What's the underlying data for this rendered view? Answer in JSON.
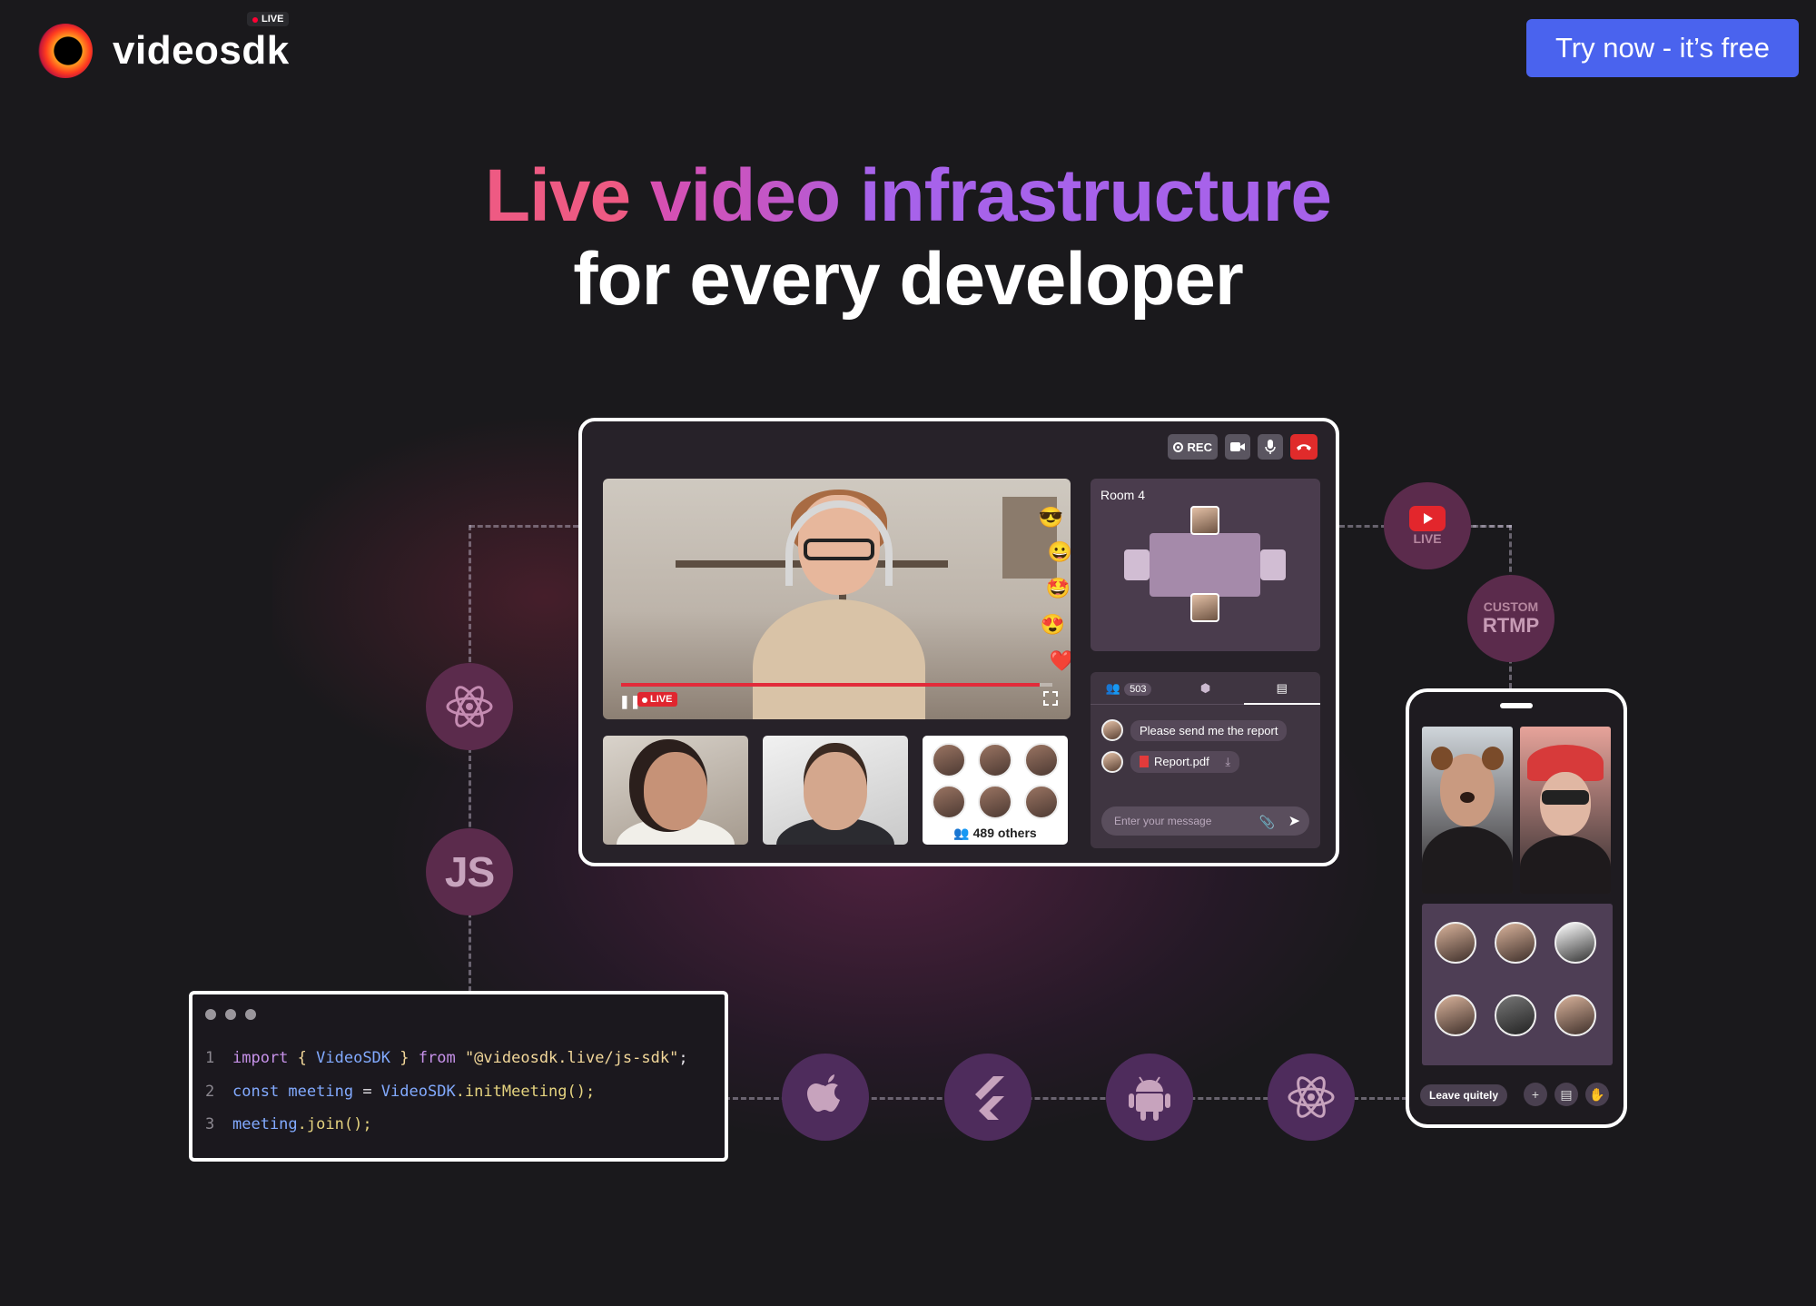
{
  "header": {
    "brand": "videosdk",
    "brand_badge": "LIVE",
    "cta_label": "Try now - it’s free"
  },
  "hero": {
    "line1_part1": "Live ",
    "line1_part2": "video ",
    "line1_part3": "infrastructure",
    "line2": "for every developer"
  },
  "call": {
    "toolbar": {
      "rec_label": "REC"
    },
    "main_video": {
      "live_label": "LIVE",
      "progress": 0.97
    },
    "others_label": "489 others",
    "room": {
      "title": "Room 4"
    },
    "chat": {
      "participants_count": "503",
      "messages": [
        {
          "text": "Please send me the report"
        },
        {
          "text": "Report.pdf"
        }
      ],
      "input_placeholder": "Enter your message"
    }
  },
  "streams": {
    "youtube_label": "LIVE",
    "rtmp_top": "CUSTOM",
    "rtmp_bottom": "RTMP"
  },
  "sdks": {
    "js_label": "JS"
  },
  "code": {
    "lines": [
      {
        "n": "1",
        "a": "import",
        "b": " { ",
        "c": "VideoSDK",
        "d": " } ",
        "e": "from",
        "f": " \"@videosdk.live/js-sdk\"",
        "g": ";"
      },
      {
        "n": "2",
        "a": "const",
        "b": " meeting",
        "c": " = ",
        "d": "VideoSDK",
        "e": ".initMeeting",
        "f": "();"
      },
      {
        "n": "3",
        "a": "meeting",
        "b": ".join",
        "c": "();"
      }
    ]
  },
  "phone": {
    "leave_label": "Leave quitely"
  },
  "icons": [
    "react-icon",
    "js-icon",
    "apple-icon",
    "flutter-icon",
    "android-icon",
    "react-native-icon",
    "youtube-icon",
    "rtmp-icon"
  ]
}
